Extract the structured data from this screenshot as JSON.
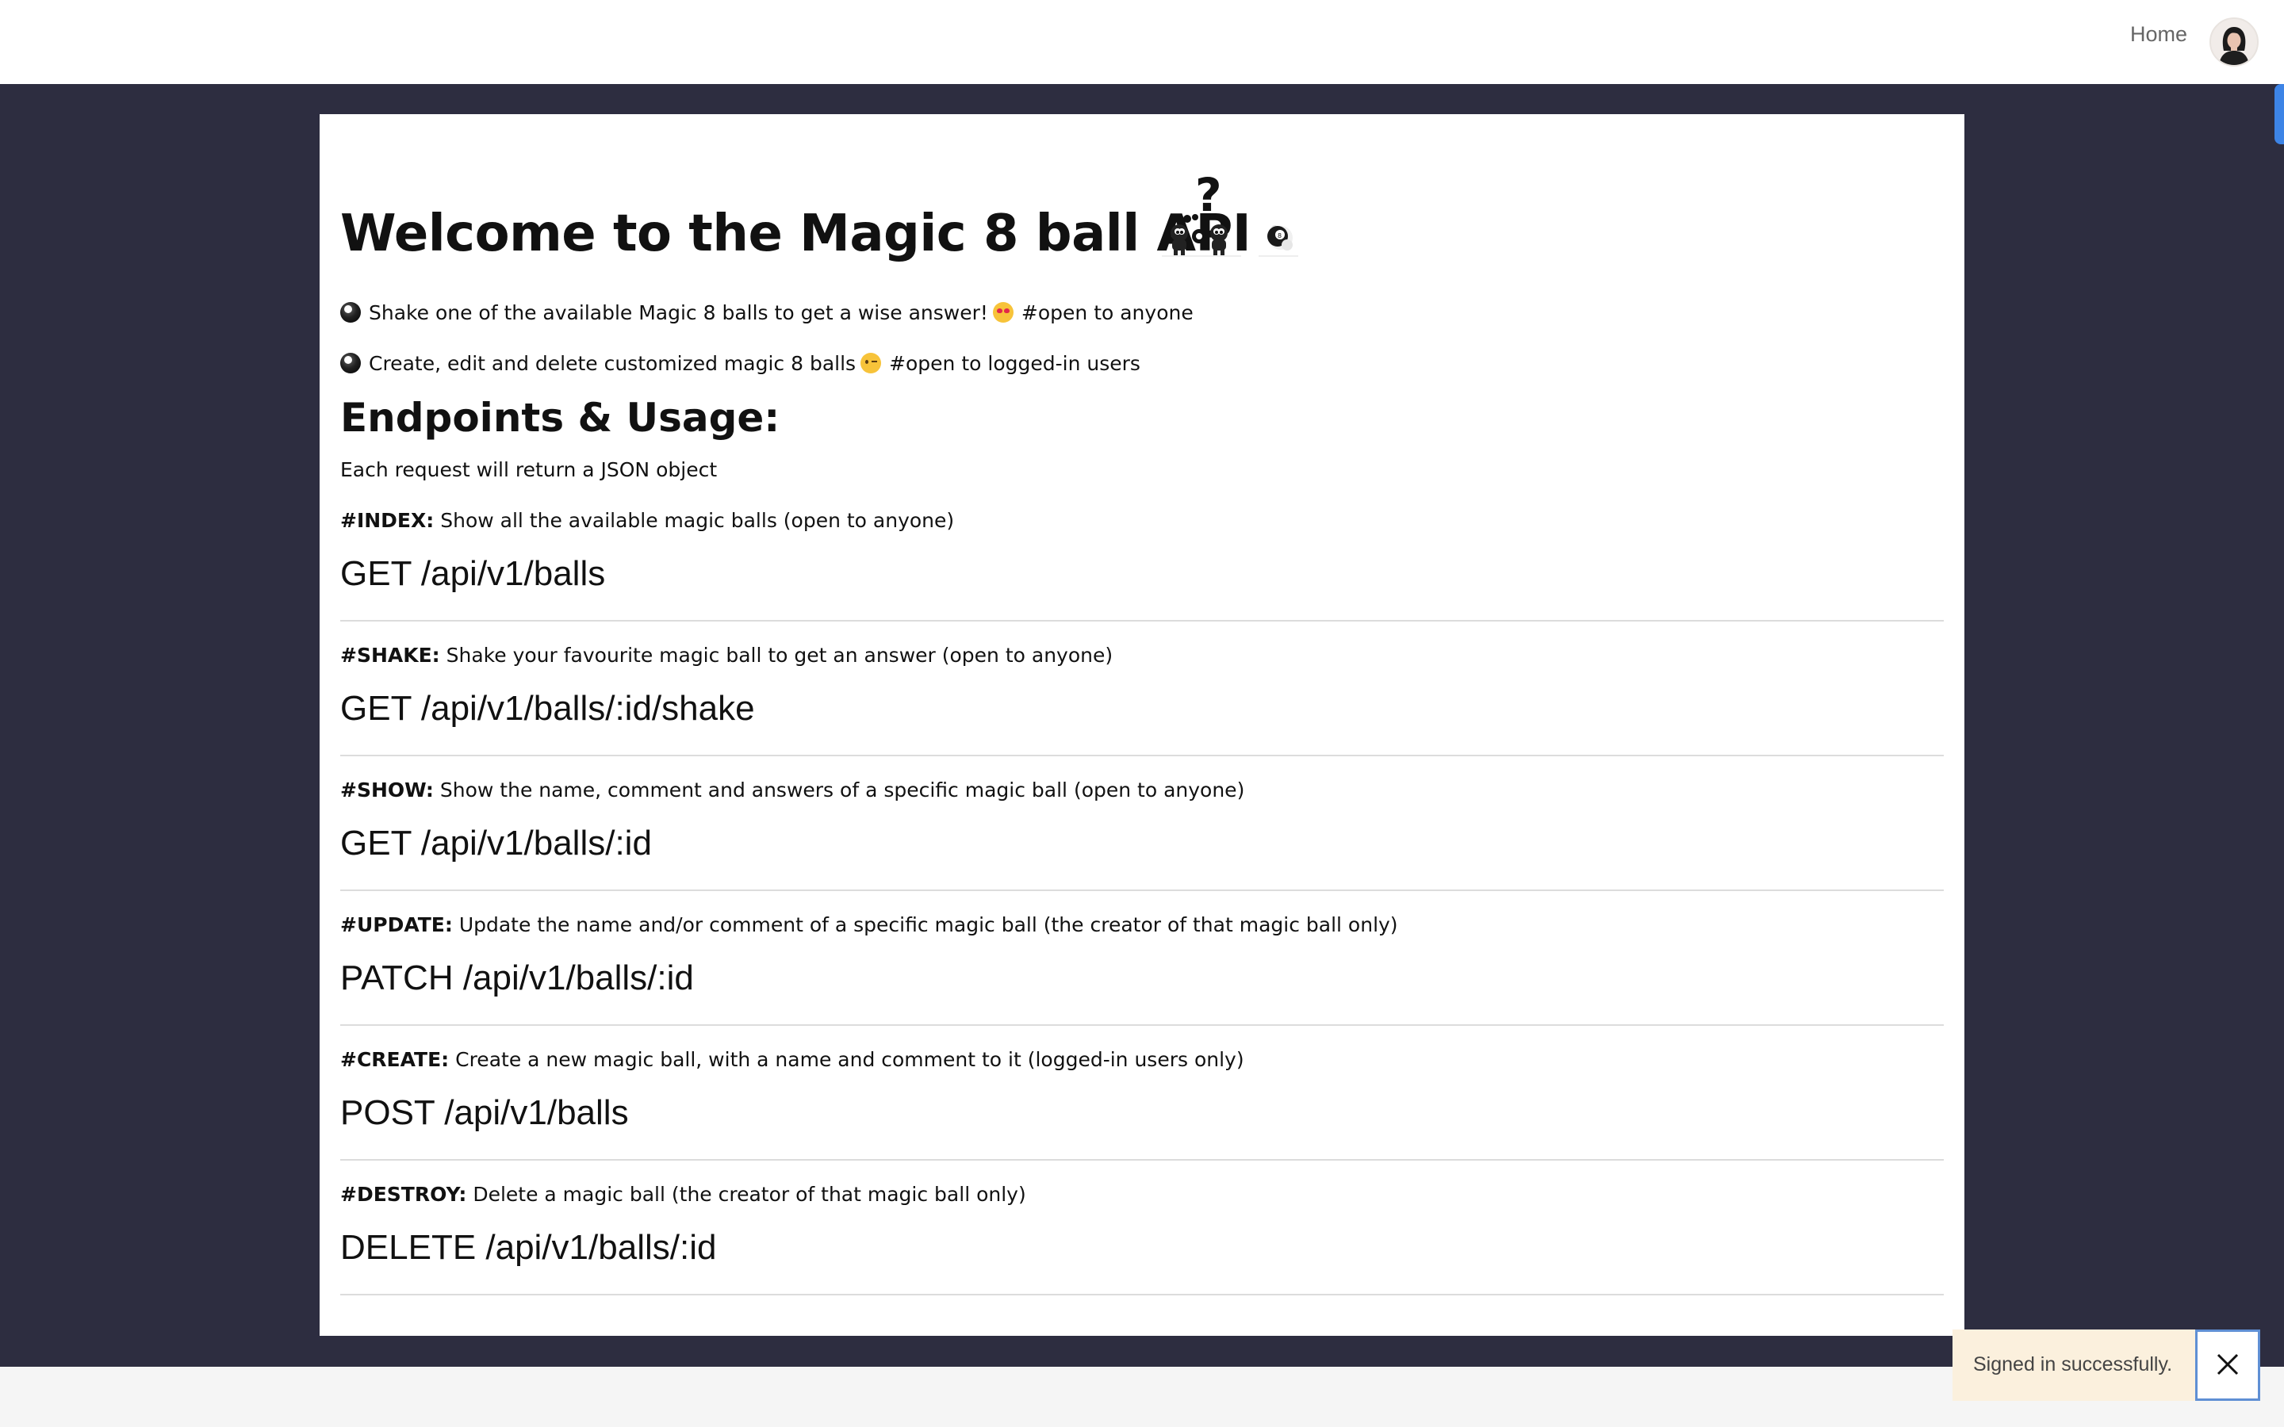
{
  "nav": {
    "home_label": "Home"
  },
  "page": {
    "title": "Welcome to the Magic 8 ball API",
    "intro": [
      {
        "text": "Shake one of the available Magic 8 balls to get a wise answer!",
        "tag": "#open to anyone"
      },
      {
        "text": "Create, edit and delete customized magic 8 balls",
        "tag": "#open to logged-in users"
      }
    ],
    "section_title": "Endpoints & Usage:",
    "json_note": "Each request will return a JSON object"
  },
  "endpoints": [
    {
      "tag": "#INDEX:",
      "description": "Show all the available magic balls (open to anyone)",
      "route": "GET /api/v1/balls"
    },
    {
      "tag": "#SHAKE:",
      "description": "Shake your favourite magic ball to get an answer (open to anyone)",
      "route": "GET /api/v1/balls/:id/shake"
    },
    {
      "tag": "#SHOW:",
      "description": "Show the name, comment and answers of a specific magic ball (open to anyone)",
      "route": "GET /api/v1/balls/:id"
    },
    {
      "tag": "#UPDATE:",
      "description": "Update the name and/or comment of a specific magic ball (the creator of that magic ball only)",
      "route": "PATCH /api/v1/balls/:id"
    },
    {
      "tag": "#CREATE:",
      "description": "Create a new magic ball, with a name and comment to it (logged-in users only)",
      "route": "POST /api/v1/balls"
    },
    {
      "tag": "#DESTROY:",
      "description": "Delete a magic ball (the creator of that magic ball only)",
      "route": "DELETE /api/v1/balls/:id"
    }
  ],
  "toast": {
    "message": "Signed in successfully."
  },
  "icons": {
    "avatar": "user-avatar",
    "magic_ball": "8-ball-emoji",
    "love_face": "heart-eyes-emoji",
    "wink_face": "winking-face-emoji",
    "close": "close-icon"
  },
  "colors": {
    "band_background": "#2d2d40",
    "card_background": "#ffffff",
    "toast_background": "#fbf0dd",
    "focus_ring": "#5f8fd4",
    "scroll_accent": "#3d84e6"
  }
}
